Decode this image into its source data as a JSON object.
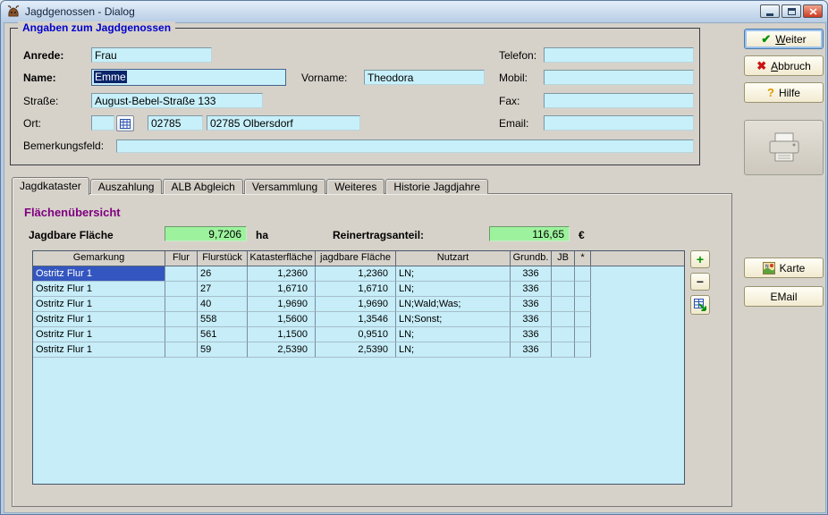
{
  "window": {
    "title": "Jagdgenossen - Dialog"
  },
  "group": {
    "title": "Angaben zum Jagdgenossen",
    "anrede_label": "Anrede:",
    "anrede_value": "Frau",
    "name_label": "Name:",
    "name_value": "Emme",
    "vorname_label": "Vorname:",
    "vorname_value": "Theodora",
    "strasse_label": "Straße:",
    "strasse_value": "August-Bebel-Straße 133",
    "ort_label": "Ort:",
    "ortcode_value": "",
    "plz_value": "02785",
    "ort_value": "02785 Olbersdorf",
    "telefon_label": "Telefon:",
    "telefon_value": "",
    "mobil_label": "Mobil:",
    "mobil_value": "",
    "fax_label": "Fax:",
    "fax_value": "",
    "email_label": "Email:",
    "email_value": "",
    "bemerkung_label": "Bemerkungsfeld:",
    "bemerkung_value": ""
  },
  "tabs": {
    "active_index": 0,
    "items": [
      "Jagdkataster",
      "Auszahlung",
      "ALB Abgleich",
      "Versammlung",
      "Weiteres",
      "Historie Jagdjahre"
    ]
  },
  "overview": {
    "heading": "Flächenübersicht",
    "area_label": "Jagdbare Fläche",
    "area_value": "9,7206",
    "area_unit": "ha",
    "yield_label": "Reinertragsanteil:",
    "yield_value": "116,65",
    "yield_unit": "€"
  },
  "table": {
    "headers": [
      "Gemarkung",
      "Flur",
      "Flurstück",
      "Katasterfläche",
      "jagdbare Fläche",
      "Nutzart",
      "Grundb.",
      "JB",
      "*"
    ],
    "rows": [
      [
        "Ostritz Flur 1",
        "",
        "26",
        "1,2360",
        "1,2360",
        "LN;",
        "336",
        "",
        ""
      ],
      [
        "Ostritz Flur 1",
        "",
        "27",
        "1,6710",
        "1,6710",
        "LN;",
        "336",
        "",
        ""
      ],
      [
        "Ostritz Flur 1",
        "",
        "40",
        "1,9690",
        "1,9690",
        "LN;Wald;Was;",
        "336",
        "",
        ""
      ],
      [
        "Ostritz Flur 1",
        "",
        "558",
        "1,5600",
        "1,3546",
        "LN;Sonst;",
        "336",
        "",
        ""
      ],
      [
        "Ostritz Flur 1",
        "",
        "561",
        "1,1500",
        "0,9510",
        "LN;",
        "336",
        "",
        ""
      ],
      [
        "Ostritz Flur 1",
        "",
        "59",
        "2,5390",
        "2,5390",
        "LN;",
        "336",
        "",
        ""
      ]
    ],
    "selected": {
      "row": 0,
      "col": 0
    }
  },
  "icons": {
    "check": "✔",
    "cancel": "✖",
    "help": "?",
    "add": "+",
    "remove": "−"
  },
  "buttons": {
    "weiter": "Weiter",
    "abbruch": "Abbruch",
    "hilfe": "Hilfe",
    "karte": "Karte",
    "email": "EMail"
  }
}
